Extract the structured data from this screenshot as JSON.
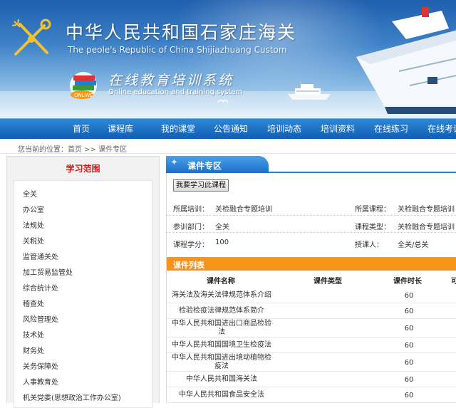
{
  "header": {
    "title_cn": "中华人民共和国石家庄海关",
    "title_en": "The peole's Republic of China Shijiazhuang Custom",
    "subtitle_cn": "在线教育培训系统",
    "subtitle_en": "Online education and training system",
    "books_badge": "ONLINE"
  },
  "nav": [
    "首页",
    "课程库",
    "我的课堂",
    "公告通知",
    "培训动态",
    "培训资料",
    "在线练习",
    "在线考试"
  ],
  "breadcrumb": "您当前的位置：首页 >> 课件专区",
  "sidebar": {
    "title": "学习范围",
    "items": [
      "全关",
      "办公室",
      "法规处",
      "关税处",
      "监管通关处",
      "加工贸易监管处",
      "综合统计处",
      "稽查处",
      "风险管理处",
      "技术处",
      "财务处",
      "关务保障处",
      "人事教育处",
      "机关党委(思想政治工作办公室)"
    ]
  },
  "panel": {
    "tab_label": "课件专区",
    "study_button": "我要学习此课程",
    "info": {
      "training_label": "所属培训：",
      "training_value": "关检融合专题培训",
      "course_label": "所属课程：",
      "course_value": "关检融合专题培训",
      "dept_label": "参训部门：",
      "dept_value": "全关",
      "type_label": "课程类型：",
      "type_value": "关检融合专题培训",
      "credit_label": "课程学分：",
      "credit_value": "100",
      "lecturer_label": "授课人：",
      "lecturer_value": "全关/总关"
    },
    "list_title": "课件列表",
    "columns": [
      "课件名称",
      "课件类型",
      "课件时长",
      "可"
    ],
    "rows": [
      {
        "name": "海关法及海关法律规范体系介绍",
        "type": "",
        "duration": "60"
      },
      {
        "name": "检验检疫法律规范体系简介",
        "type": "",
        "duration": "60"
      },
      {
        "name": "中华人民共和国进出口商品检验法",
        "type": "",
        "duration": "60"
      },
      {
        "name": "中华人民共和国国境卫生检疫法",
        "type": "",
        "duration": "60"
      },
      {
        "name": "中华人民共和国进出境动植物检疫法",
        "type": "",
        "duration": "60"
      },
      {
        "name": "中华人民共和国海关法",
        "type": "",
        "duration": "60"
      },
      {
        "name": "中华人民共和国食品安全法",
        "type": "",
        "duration": "60"
      }
    ]
  },
  "colors": {
    "nav_blue": "#1c6fc7",
    "accent_orange": "#f7941d",
    "sidebar_title_red": "#e0121a"
  }
}
